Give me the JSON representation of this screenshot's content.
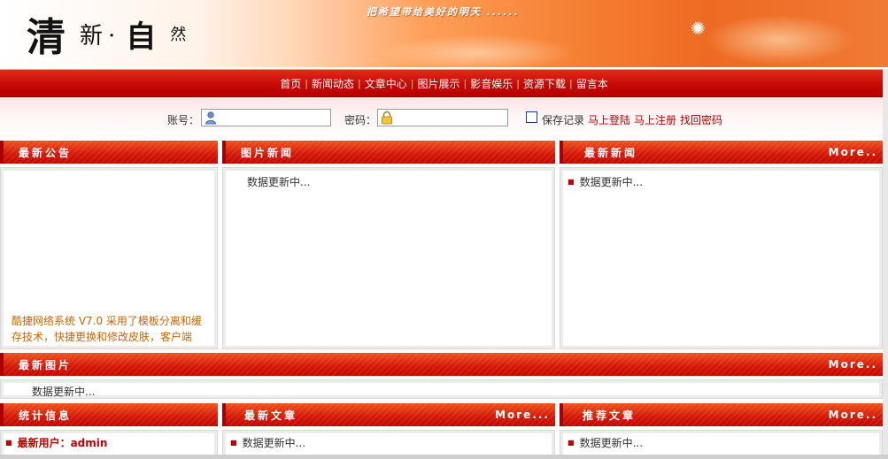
{
  "header": {
    "logo": {
      "c1": "清",
      "c2": "新·",
      "c3": "自",
      "c4": "然"
    },
    "slogan": "把希望带给美好的明天 ......"
  },
  "nav": {
    "items": [
      "首页",
      "新闻动态",
      "文章中心",
      "图片展示",
      "影音娱乐",
      "资源下载",
      "留言本"
    ],
    "separator": "|"
  },
  "login": {
    "account_label": "账号：",
    "account_value": "",
    "password_label": "密码：",
    "password_value": "",
    "remember_label": "保存记录",
    "login_link": "马上登陆",
    "register_link": "马上注册",
    "recover_link": "找回密码"
  },
  "panels": {
    "announce": {
      "title": "最新公告",
      "text": "酷捷网络系统 V7.0 采用了模板分离和缓存技术，快捷更换和修改皮肤，客户端采用Div+CSS结构，使用方便快捷"
    },
    "photo_news": {
      "title": "图片新闻",
      "placeholder": "数据更新中..."
    },
    "latest_news": {
      "title": "最新新闻",
      "more": "More..",
      "item": "数据更新中..."
    },
    "latest_images": {
      "title": "最新图片",
      "more": "More..",
      "placeholder": "数据更新中..."
    },
    "stats": {
      "title": "统计信息",
      "latest_user_label": "最新用户：",
      "latest_user": "admin"
    },
    "latest_articles": {
      "title": "最新文章",
      "more": "More...",
      "item": "数据更新中..."
    },
    "recommended": {
      "title": "推荐文章",
      "more": "More..",
      "item": "数据更新中..."
    }
  },
  "colors": {
    "nav_red": "#c50a05",
    "link_red": "#c00000",
    "notice_orange": "#cc6600"
  }
}
